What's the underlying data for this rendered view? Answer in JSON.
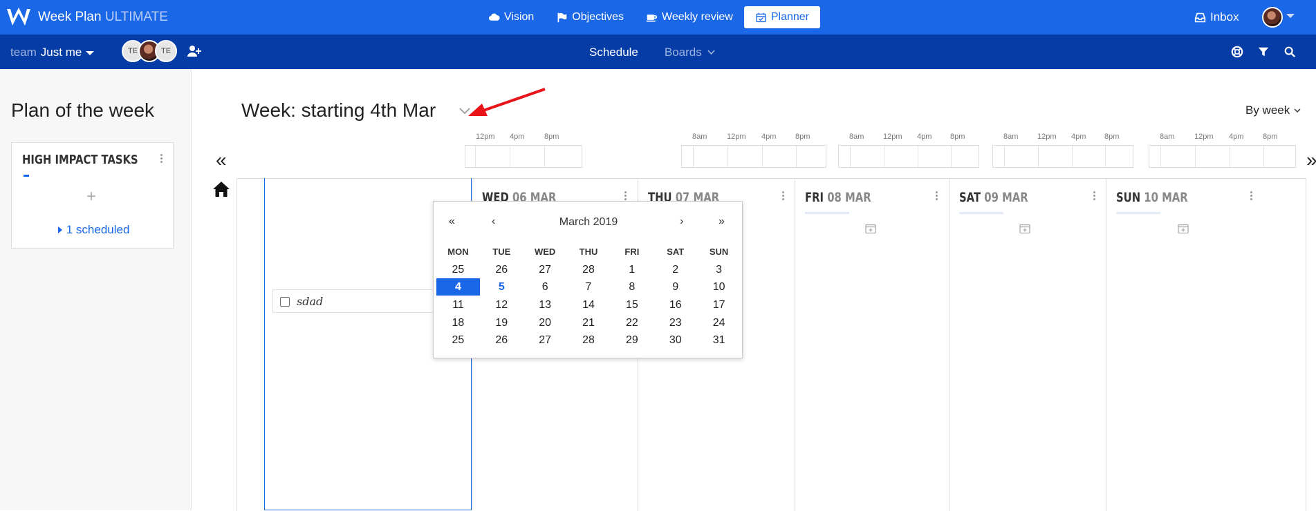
{
  "app": {
    "brand_name": "Week Plan",
    "brand_edition": "ULTIMATE",
    "colors": {
      "primary": "#1a68e8",
      "secondary_bar": "#053ca5",
      "arrow": "#e8141a"
    }
  },
  "topnav": [
    {
      "label": "Vision",
      "icon": "cloud-icon"
    },
    {
      "label": "Objectives",
      "icon": "flag-icon"
    },
    {
      "label": "Weekly review",
      "icon": "coffee-icon"
    },
    {
      "label": "Planner",
      "icon": "calendar-check-icon",
      "active": true
    }
  ],
  "inbox_label": "Inbox",
  "subbar": {
    "team_label": "team",
    "team_value": "Just me",
    "avatars": [
      "TE",
      "",
      "TE"
    ],
    "schedule_label": "Schedule",
    "boards_label": "Boards"
  },
  "sidebar": {
    "title": "Plan of the week",
    "card_title": "HIGH IMPACT TASKS",
    "add_symbol": "+",
    "scheduled_label": "1 scheduled"
  },
  "main": {
    "week_title": "Week: starting 4th Mar",
    "view_selector": "By week",
    "prev_symbol": "«",
    "next_symbol": "»",
    "timeline_labels": [
      "8am",
      "12pm",
      "4pm",
      "8pm"
    ]
  },
  "days": [
    {
      "name": "WED",
      "date": "06 MAR"
    },
    {
      "name": "THU",
      "date": "07 MAR"
    },
    {
      "name": "FRI",
      "date": "08 MAR"
    },
    {
      "name": "SAT",
      "date": "09 MAR"
    },
    {
      "name": "SUN",
      "date": "10 MAR"
    }
  ],
  "task": {
    "text": "sdad",
    "checked": false
  },
  "calendar": {
    "month_label": "March 2019",
    "nav": {
      "prev_year": "«",
      "prev_month": "‹",
      "next_month": "›",
      "next_year": "»"
    },
    "weekdays": [
      "MON",
      "TUE",
      "WED",
      "THU",
      "FRI",
      "SAT",
      "SUN"
    ],
    "weeks": [
      [
        "25",
        "26",
        "27",
        "28",
        "1",
        "2",
        "3"
      ],
      [
        "4",
        "5",
        "6",
        "7",
        "8",
        "9",
        "10"
      ],
      [
        "11",
        "12",
        "13",
        "14",
        "15",
        "16",
        "17"
      ],
      [
        "18",
        "19",
        "20",
        "21",
        "22",
        "23",
        "24"
      ],
      [
        "25",
        "26",
        "27",
        "28",
        "29",
        "30",
        "31"
      ]
    ],
    "selected": "4",
    "today": "5"
  }
}
